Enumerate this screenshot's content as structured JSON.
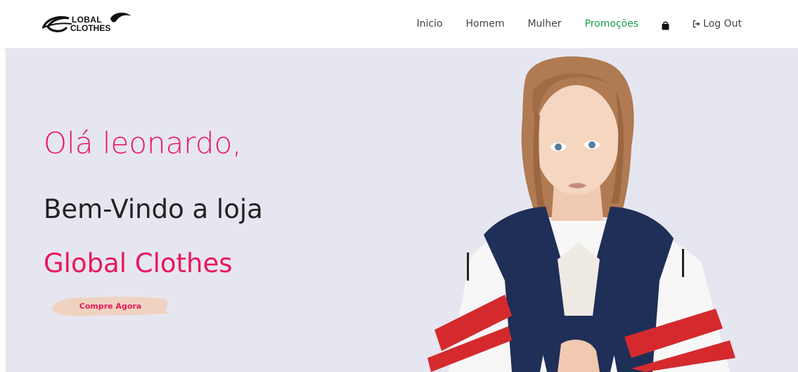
{
  "brand_logo": {
    "line1": "LOBAL",
    "line2": "CLOTHES"
  },
  "nav": {
    "items": [
      {
        "label": "Inicio",
        "active": false
      },
      {
        "label": "Homem",
        "active": false
      },
      {
        "label": "Mulher",
        "active": false
      },
      {
        "label": "Promoções",
        "active": true
      }
    ],
    "bag_icon": "shopping-bag-icon",
    "logout_label": "Log Out",
    "logout_icon": "sign-out-icon"
  },
  "hero": {
    "greeting": "Olá leonardo,",
    "welcome": "Bem-Vindo a loja",
    "brand_name": "Global Clothes",
    "cta_label": "Compre Agora"
  },
  "colors": {
    "accent_pink": "#e8175d",
    "active_green": "#1b9e4b",
    "hero_bg": "#e6e6f0",
    "cta_brush": "#efd3c0"
  }
}
